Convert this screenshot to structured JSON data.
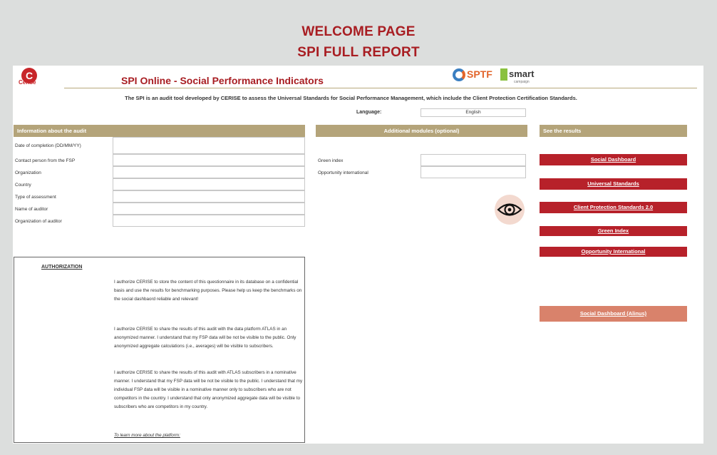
{
  "header": {
    "line1": "WELCOME PAGE",
    "line2": "SPI FULL REPORT"
  },
  "brand": {
    "cerise_logo_text": "Cerise",
    "sptf_logo_text": "SPTF",
    "smart_logo_text": "smart",
    "smart_logo_sub": "campaign"
  },
  "sheet": {
    "title": "SPI Online - Social Performance Indicators",
    "intro": "The SPI is an audit tool developed by CERISE to assess the Universal Standards for Social Performance Management, which include the Client Protection Certification Standards.",
    "language_label": "Language:",
    "language_value": "English"
  },
  "audit": {
    "header": "Information about the audit",
    "fields": [
      "Date of completion (DD/MM/YY)",
      "Contact person from the FSP",
      "Organization",
      "Country",
      "Type of assessment",
      "Name of auditor",
      "Organization of auditor"
    ]
  },
  "modules": {
    "header": "Additional modules (optional)",
    "fields": [
      "Green index",
      "Opportunity international"
    ]
  },
  "results": {
    "header": "See the results",
    "buttons": [
      "Social Dashboard",
      "Universal Standards",
      "Client Protection Standards 2.0",
      "Green Index",
      "Opportunity International"
    ],
    "alinus_button": "Social Dashboard (Alinus)"
  },
  "authorization": {
    "title": "AUTHORIZATION",
    "paragraphs": [
      "I authorize CERISE to store the content of this questionnaire in its database on a confidential basis and use the results for benchmarking purposes. Please help us keep the benchmarks on the social dashbaord reliable and relevant!",
      "I authorize CERISE to share the results of this audit with the data platform ATLAS in an anonymized manner. I understand that my FSP data will be not be visible to the public. Only anonymized aggregate calculations (i.e., averages) will be visible to subscribers.",
      "I authorize CERISE to share the results of this audit with ATLAS subscribers in a nominative manner. I understand that my FSP data will be not be visible to the public. I understand that my individual FSP data will be visible in a nominative manner only to subscribers who are not competitors in the country. I understand that only anonymized aggregate data will be visible to subscribers who are competitors in my country."
    ],
    "learn_more": "To learn more about the platform:"
  },
  "icons": {
    "eye": "eye-icon"
  },
  "colors": {
    "accent": "#a81d22",
    "band": "#b4a47a",
    "button": "#b7212a",
    "button_light": "#d9826b"
  }
}
